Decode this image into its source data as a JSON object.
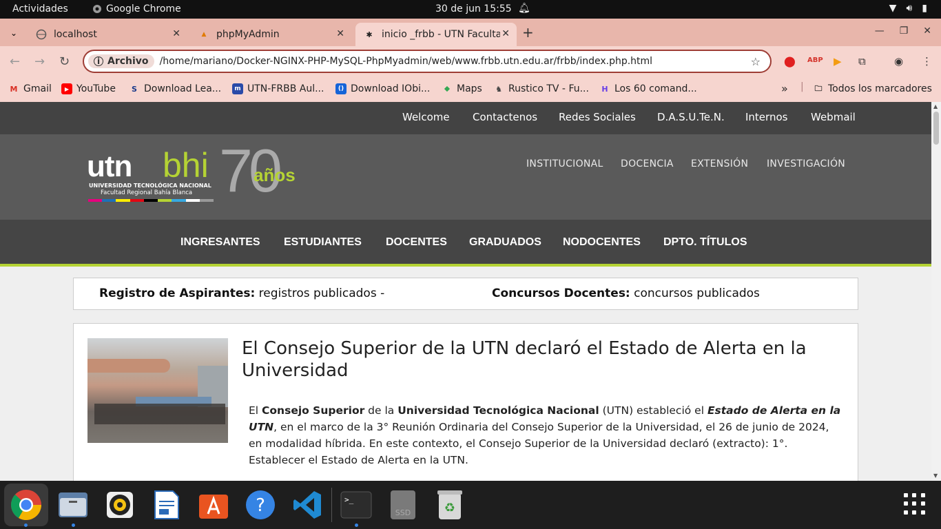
{
  "system": {
    "activities": "Actividades",
    "app_name": "Google Chrome",
    "clock": "30 de jun  15:55"
  },
  "browser": {
    "tabs": [
      {
        "title": "localhost"
      },
      {
        "title": "phpMyAdmin"
      },
      {
        "title": "inicio _frbb - UTN Faculta"
      }
    ],
    "address": {
      "chip": "Archivo",
      "url": "/home/mariano/Docker-NGINX-PHP-MySQL-PhpMyadmin/web/www.frbb.utn.edu.ar/frbb/index.php.html"
    },
    "bookmarks": [
      {
        "label": "Gmail"
      },
      {
        "label": "YouTube"
      },
      {
        "label": "Download Lea..."
      },
      {
        "label": "UTN-FRBB Aul..."
      },
      {
        "label": "Download IObi..."
      },
      {
        "label": "Maps"
      },
      {
        "label": "Rustico TV - Fu..."
      },
      {
        "label": "Los 60 comand..."
      }
    ],
    "overflow": "»",
    "all_bookmarks": "Todos los marcadores"
  },
  "site": {
    "top_nav": [
      "Welcome",
      "Contactenos",
      "Redes Sociales",
      "D.A.S.U.Te.N.",
      "Internos",
      "Webmail"
    ],
    "logo": {
      "utn": "utn",
      "bhi": "bhi",
      "seventy": "70",
      "anios": "años",
      "line1": "UNIVERSIDAD TECNOLÓGICA NACIONAL",
      "line2": "Facultad Regional Bahía Blanca"
    },
    "header_menu": [
      "INSTITUCIONAL",
      "DOCENCIA",
      "EXTENSIÓN",
      "INVESTIGACIÓN"
    ],
    "main_nav": [
      "INGRESANTES",
      "ESTUDIANTES",
      "DOCENTES",
      "GRADUADOS",
      "NODOCENTES",
      "DPTO. TÍTULOS"
    ],
    "registro": {
      "label": "Registro de Aspirantes:",
      "text": " registros publicados -"
    },
    "concursos": {
      "label": "Concursos Docentes:",
      "text": " concursos publicados"
    },
    "news": {
      "title": "El Consejo Superior de la UTN declaró el Estado de Alerta en la Universidad",
      "p1": "El ",
      "b1": "Consejo Superior",
      "p2": " de la ",
      "b2": "Universidad Tecnológica Nacional",
      "p3": " (UTN) estableció el ",
      "b3": "Estado de Alerta en la UTN",
      "p4": ", en el marco de la 3° Reunión Ordinaria del Consejo Superior de la Universidad, el 26 de junio de 2024, en modalidad híbrida. En este contexto, el Consejo Superior de la Universidad declaró (extracto): 1°. Establecer el Estado de Alerta en la UTN."
    }
  },
  "colors": {
    "accent": "#b5d334",
    "tab_bar": "#e8b6ab",
    "toolbar": "#f6d5cf"
  }
}
